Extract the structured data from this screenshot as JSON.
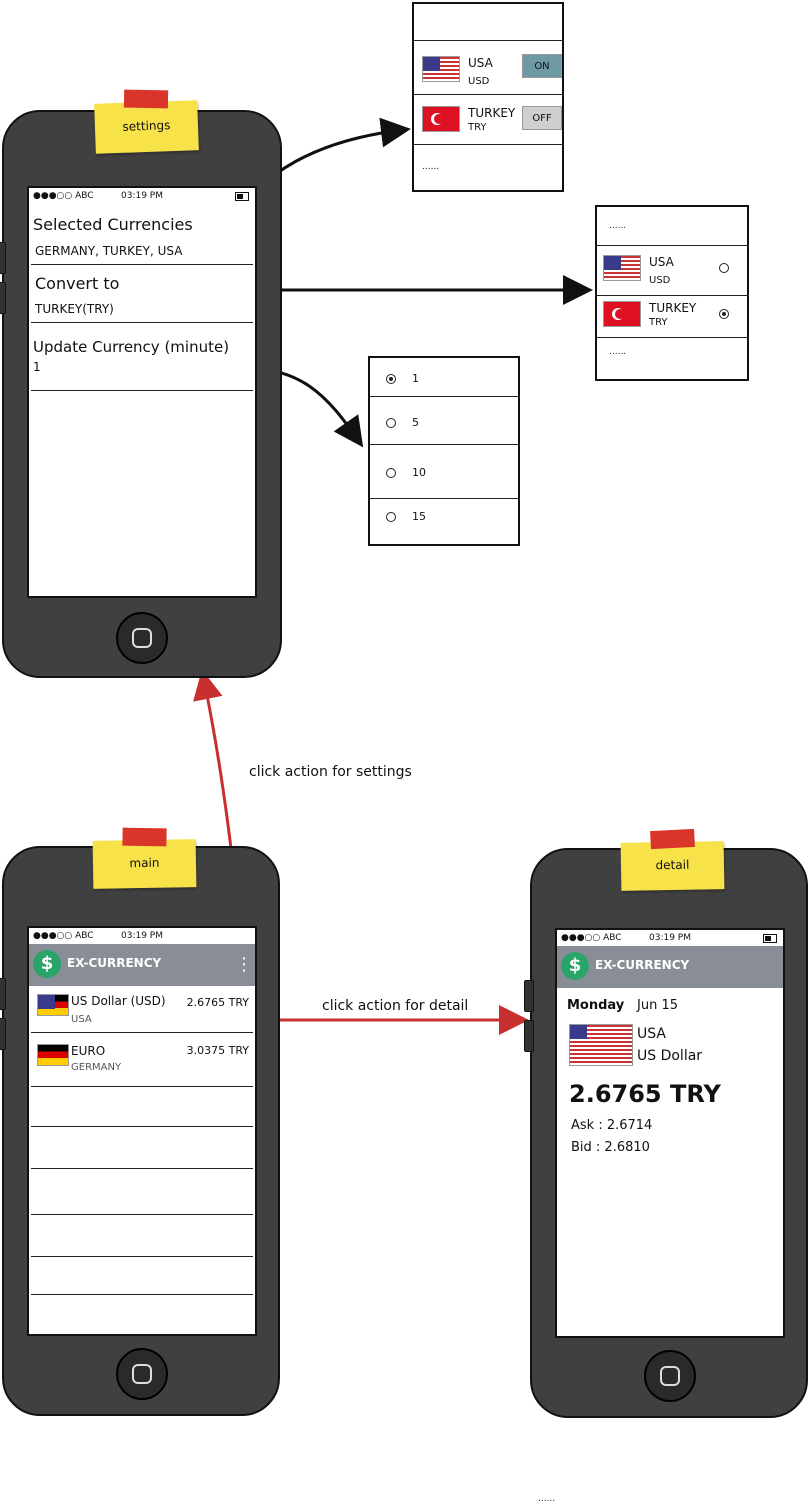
{
  "status_bar": {
    "carrier": "●●●○○ ABC",
    "time": "03:19 PM"
  },
  "notes": {
    "settings": "settings",
    "main": "main",
    "detail": "detail"
  },
  "settings_screen": {
    "selected_title": "Selected Currencies",
    "selected_value": "GERMANY, TURKEY, USA",
    "convert_title": "Convert to",
    "convert_value": "TURKEY(TRY)",
    "update_title": "Update Currency (minute)",
    "update_value": "1"
  },
  "toggle_popup": {
    "items": [
      {
        "country": "USA",
        "code": "USD",
        "state": "ON",
        "flag": "us-flag-icon"
      },
      {
        "country": "TURKEY",
        "code": "TRY",
        "state": "OFF",
        "flag": "tr-flag-icon"
      }
    ],
    "more": "......"
  },
  "convert_popup": {
    "top_more": "......",
    "items": [
      {
        "country": "USA",
        "code": "USD",
        "selected": false
      },
      {
        "country": "TURKEY",
        "code": "TRY",
        "selected": true
      }
    ],
    "bottom_more": "......"
  },
  "minute_popup": {
    "options": [
      "1",
      "5",
      "10",
      "15"
    ],
    "selected": "1"
  },
  "annotations": {
    "settings": "click action for settings",
    "detail": "click action for detail"
  },
  "main_screen": {
    "app_title": "EX-CURRENCY",
    "menu_icon": "⋮",
    "rows": [
      {
        "name": "US Dollar (USD)",
        "country": "USA",
        "rate": "2.6765 TRY"
      },
      {
        "name": "EURO",
        "country": "GERMANY",
        "rate": "3.0375 TRY"
      }
    ]
  },
  "detail_screen": {
    "app_title": "EX-CURRENCY",
    "day": "Monday",
    "date": "Jun 15",
    "country": "USA",
    "currency": "US Dollar",
    "rate": "2.6765 TRY",
    "ask": "Ask : 2.6714",
    "bid": "Bid :  2.6810"
  },
  "footer": "......",
  "colors": {
    "arrow_black": "#111111",
    "arrow_red": "#c83030",
    "appbar": "#888d96",
    "sticky": "#f7e24a",
    "toggle_on": "#6f9aa3",
    "toggle_off": "#cfcfcf"
  }
}
